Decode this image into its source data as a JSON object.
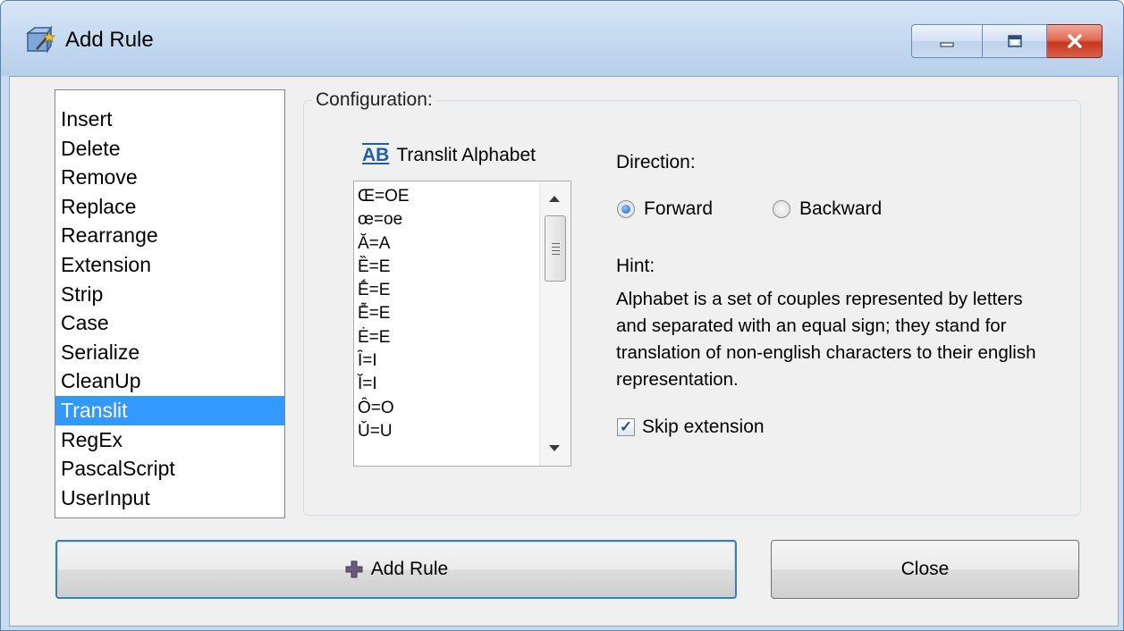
{
  "window": {
    "title": "Add Rule",
    "icon": "folder-wand-icon"
  },
  "rule_list": {
    "items": [
      "Insert",
      "Delete",
      "Remove",
      "Replace",
      "Rearrange",
      "Extension",
      "Strip",
      "Case",
      "Serialize",
      "CleanUp",
      "Translit",
      "RegEx",
      "PascalScript",
      "UserInput"
    ],
    "selected": "Translit"
  },
  "configuration": {
    "label": "Configuration:",
    "translit_header": {
      "icon_text": "AB",
      "label": "Translit Alphabet"
    },
    "alphabet": [
      "Œ=OE",
      "œ=oe",
      "Ă=A",
      "Ȅ=E",
      "Ḗ=E",
      "Ễ=E",
      "Ė=E",
      "Ȋ=I",
      "Ĭ=I",
      "Ȏ=O",
      "Ǔ=U"
    ],
    "direction": {
      "label": "Direction:",
      "forward": "Forward",
      "backward": "Backward",
      "selected": "Forward"
    },
    "hint": {
      "label": "Hint:",
      "text": "Alphabet is a set of couples represented by letters and separated with an equal sign; they stand for translation of non-english characters to their english representation."
    },
    "skip_extension": {
      "label": "Skip extension",
      "checked": true
    }
  },
  "buttons": {
    "add_rule": "Add Rule",
    "close": "Close"
  }
}
